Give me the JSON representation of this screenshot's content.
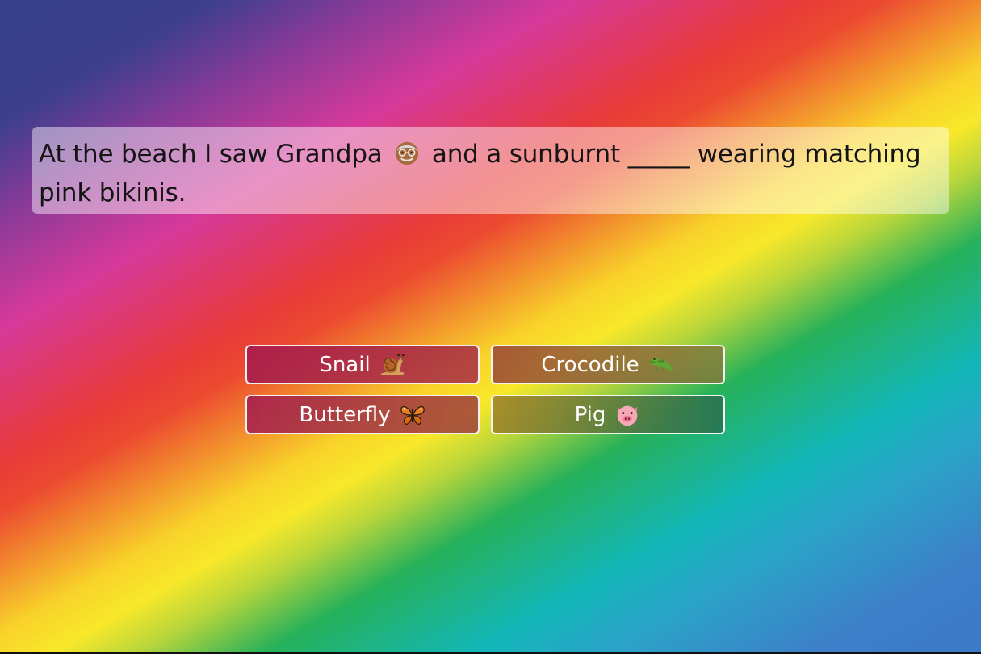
{
  "question": {
    "before": "At the beach I saw Grandpa",
    "after": "and a sunburnt _____ wearing matching pink bikinis.",
    "emoji_icon": "old-man-face-icon"
  },
  "answers": [
    {
      "label": "Snail",
      "icon": "snail-icon"
    },
    {
      "label": "Crocodile",
      "icon": "crocodile-icon"
    },
    {
      "label": "Butterfly",
      "icon": "butterfly-icon"
    },
    {
      "label": "Pig",
      "icon": "pig-face-icon"
    }
  ],
  "colors": {
    "background_gradient": [
      "#35408c",
      "#d6399a",
      "#e83a3a",
      "#f8e82a",
      "#27b15a",
      "#12b6b8",
      "#3d7fc8"
    ],
    "button_border": "#ffffff",
    "question_box": "#ffffff"
  }
}
